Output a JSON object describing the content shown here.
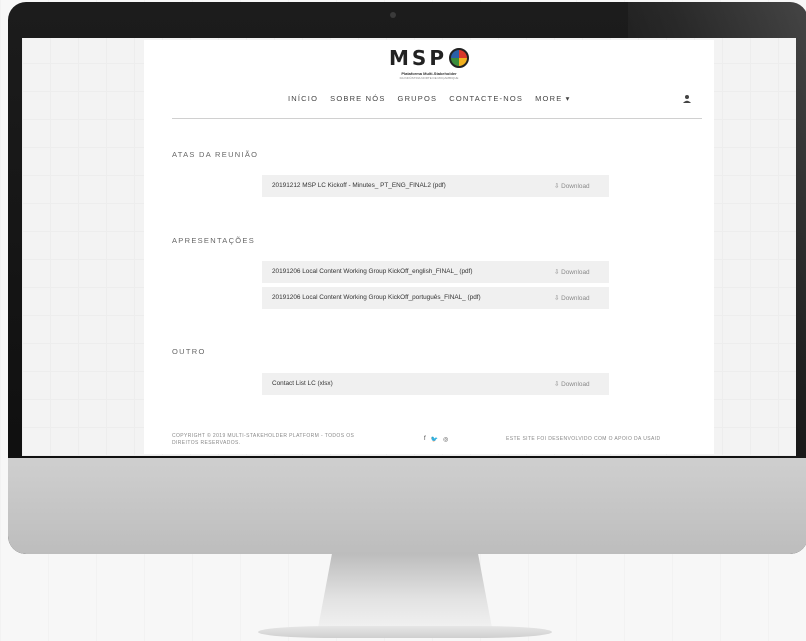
{
  "logo": {
    "text": "MSP",
    "subtitle": "Plataforma Multi-Stakeholder",
    "tagline": "DA INDÚSTRIA NORTE DE MOÇAMBIQUE"
  },
  "nav": {
    "items": [
      "INÍCIO",
      "SOBRE NÓS",
      "GRUPOS",
      "CONTACTE-NOS",
      "MORE ▾"
    ],
    "user_icon": "user-icon"
  },
  "sections": {
    "minutes": {
      "title": "ATAS DA REUNIÃO",
      "files": [
        {
          "name": "20191212 MSP LC Kickoff - Minutes_ PT_ENG_FINAL2 (pdf)",
          "action": "⇩ Download"
        }
      ]
    },
    "presentations": {
      "title": "APRESENTAÇÕES",
      "files": [
        {
          "name": "20191206 Local Content Working Group KickOff_english_FINAL_ (pdf)",
          "action": "⇩ Download"
        },
        {
          "name": "20191206 Local Content Working Group KickOff_português_FINAL_ (pdf)",
          "action": "⇩ Download"
        }
      ]
    },
    "other": {
      "title": "OUTRO",
      "files": [
        {
          "name": "Contact List LC (xlsx)",
          "action": "⇩ Download"
        }
      ]
    }
  },
  "footer": {
    "copyright": "COPYRIGHT © 2019 MULTI-STAKEHOLDER PLATFORM - TODOS OS DIREITOS RESERVADOS.",
    "social": [
      "f",
      "🐦",
      "◎"
    ],
    "credit": "ESTE SITE FOI DESENVOLVIDO COM O APOIO DA USAID"
  }
}
